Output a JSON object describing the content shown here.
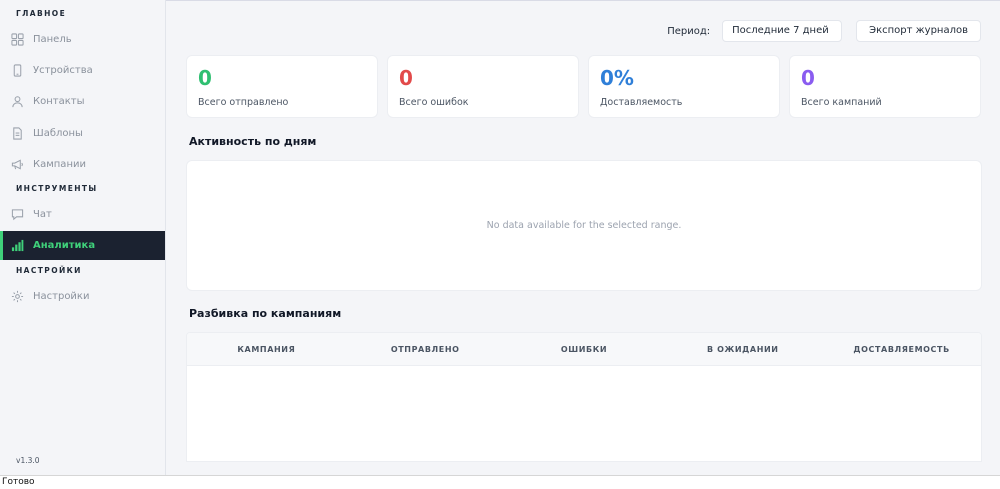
{
  "sidebar": {
    "sections": {
      "main": "ГЛАВНОЕ",
      "tools": "ИНСТРУМЕНТЫ",
      "settings": "НАСТРОЙКИ"
    },
    "items": {
      "dashboard": {
        "label": "Панель",
        "icon": "grid-icon"
      },
      "devices": {
        "label": "Устройства",
        "icon": "phone-icon"
      },
      "contacts": {
        "label": "Контакты",
        "icon": "user-icon"
      },
      "templates": {
        "label": "Шаблоны",
        "icon": "document-icon"
      },
      "campaigns": {
        "label": "Кампании",
        "icon": "megaphone-icon"
      },
      "chat": {
        "label": "Чат",
        "icon": "chat-icon"
      },
      "analytics": {
        "label": "Аналитика",
        "icon": "bar-chart-icon",
        "active": true
      },
      "settings": {
        "label": "Настройки",
        "icon": "gear-icon"
      }
    },
    "version": "v1.3.0"
  },
  "topbar": {
    "period_label": "Период:",
    "period_value": "Последние 7 дней",
    "export_label": "Экспорт журналов"
  },
  "stats": [
    {
      "value": "0",
      "label": "Всего отправлено",
      "color": "#2fbf71"
    },
    {
      "value": "0",
      "label": "Всего ошибок",
      "color": "#e24a4a"
    },
    {
      "value": "0%",
      "label": "Доставляемость",
      "color": "#2f7fd8"
    },
    {
      "value": "0",
      "label": "Всего кампаний",
      "color": "#8a5cf0"
    }
  ],
  "activity": {
    "title": "Активность по дням",
    "empty_text": "No data available for the selected range."
  },
  "breakdown": {
    "title": "Разбивка по кампаниям",
    "columns": [
      "КАМПАНИЯ",
      "ОТПРАВЛЕНО",
      "ОШИБКИ",
      "В ОЖИДАНИИ",
      "ДОСТАВЛЯЕМОСТЬ"
    ]
  },
  "statusbar": {
    "text": "Готово"
  },
  "colors": {
    "accent": "#3fd17a",
    "active_bg": "#1b2230"
  }
}
